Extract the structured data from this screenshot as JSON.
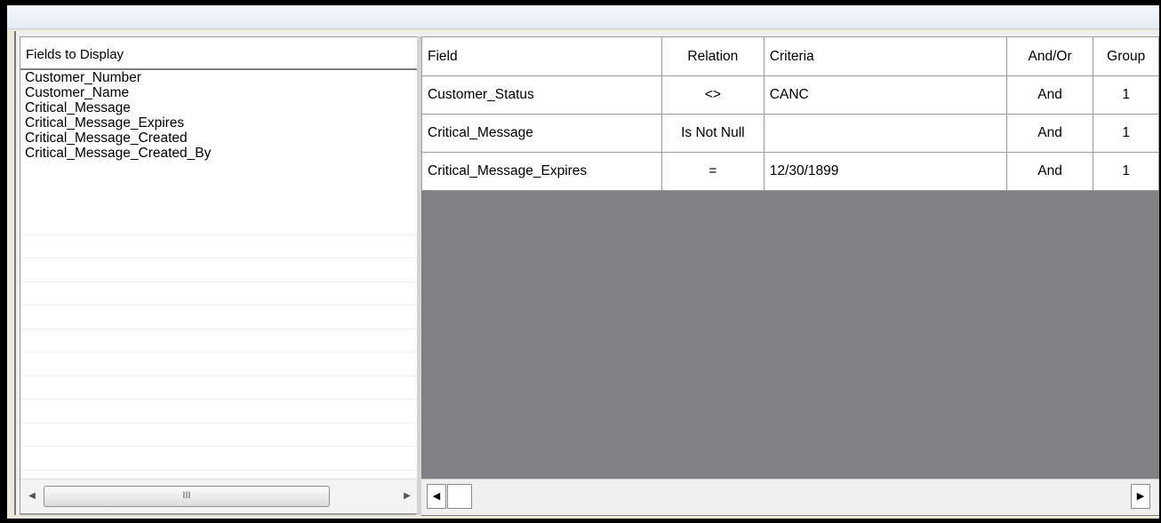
{
  "fields_panel": {
    "header": "Fields to Display",
    "items": [
      "Customer_Number",
      "Customer_Name",
      "Critical_Message",
      "Critical_Message_Expires",
      "Critical_Message_Created",
      "Critical_Message_Created_By"
    ],
    "scroll_thumb_glyph": "III"
  },
  "criteria_grid": {
    "columns": {
      "field": "Field",
      "relation": "Relation",
      "criteria": "Criteria",
      "andor": "And/Or",
      "group": "Group"
    },
    "rows": [
      {
        "field": "Customer_Status",
        "relation": "<>",
        "criteria": "CANC",
        "andor": "And",
        "group": "1"
      },
      {
        "field": "Critical_Message",
        "relation": "Is Not Null",
        "criteria": "",
        "andor": "And",
        "group": "1"
      },
      {
        "field": "Critical_Message_Expires",
        "relation": "=",
        "criteria": "12/30/1899",
        "andor": "And",
        "group": "1"
      }
    ]
  },
  "colors": {
    "empty_grid_background": "#818083",
    "frame": "#000000"
  }
}
